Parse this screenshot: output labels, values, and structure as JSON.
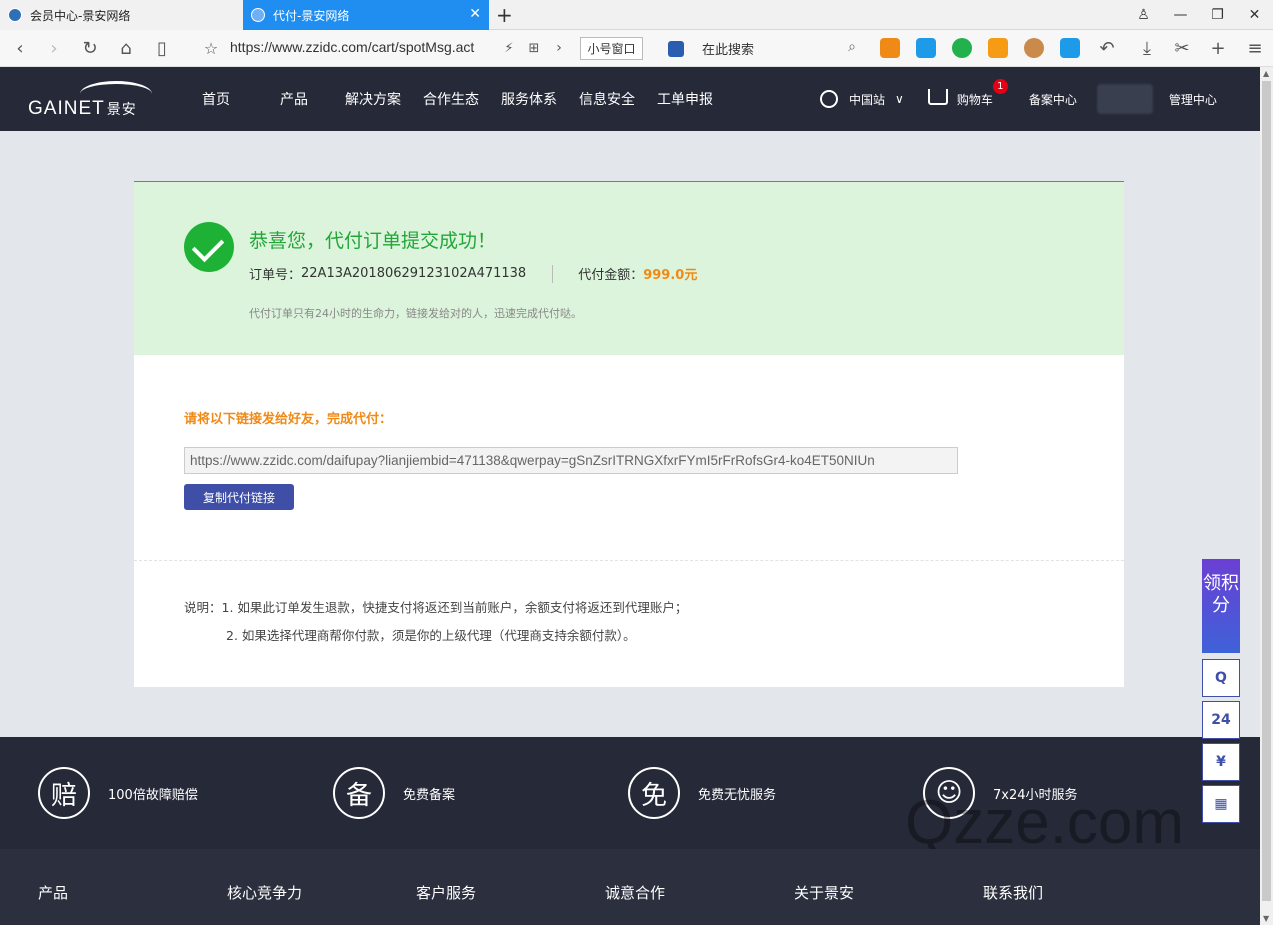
{
  "browser": {
    "tabs": [
      {
        "title": "会员中心-景安网络",
        "active": false
      },
      {
        "title": "代付-景安网络",
        "active": true
      }
    ],
    "url": "https://www.zzidc.com/cart/spotMsg.act",
    "small_window_label": "小号窗口",
    "search_placeholder": "在此搜索"
  },
  "header": {
    "logo_text": "GAINET",
    "logo_cn": "景安",
    "nav": [
      "首页",
      "产品",
      "解决方案",
      "合作生态",
      "服务体系",
      "信息安全",
      "工单申报"
    ],
    "region": "中国站",
    "cart_label": "购物车",
    "cart_count": "1",
    "beian_label": "备案中心",
    "admin_label": "管理中心"
  },
  "success": {
    "title": "恭喜您，代付订单提交成功！",
    "order_label": "订单号：",
    "order_no": "22A13A20180629123102A471138",
    "amount_label": "代付金额：",
    "amount": "999.0元",
    "note": "代付订单只有24小时的生命力，链接发给对的人，迅速完成代付哒。"
  },
  "share": {
    "label": "请将以下链接发给好友，完成代付：",
    "link": "https://www.zzidc.com/daifupay?lianjiembid=471138&qwerpay=gSnZsrITRNGXfxrFYmI5rFrRofsGr4-ko4ET50NIUn",
    "copy_button": "复制代付链接"
  },
  "notes": {
    "line1": "说明：1. 如果此订单发生退款，快捷支付将返还到当前账户，余额支付将返还到代理账户；",
    "line2": "2. 如果选择代理商帮你付款，须是你的上级代理（代理商支持余额付款）。"
  },
  "features": [
    {
      "icon": "赔",
      "label": "100倍故障赔偿"
    },
    {
      "icon": "备",
      "label": "免费备案"
    },
    {
      "icon": "免",
      "label": "免费无忧服务"
    },
    {
      "icon": "☺",
      "label": "7x24小时服务"
    }
  ],
  "watermark": "Qzze.com",
  "footer_nav": [
    "产品",
    "核心竞争力",
    "客户服务",
    "诚意合作",
    "关于景安",
    "联系我们"
  ],
  "side": {
    "promo": "领积分",
    "phone_label": "24"
  },
  "colors": {
    "header_bg": "#252938",
    "success_green": "#22a639",
    "accent_orange": "#f08a16",
    "button_blue": "#3f4fa8"
  }
}
